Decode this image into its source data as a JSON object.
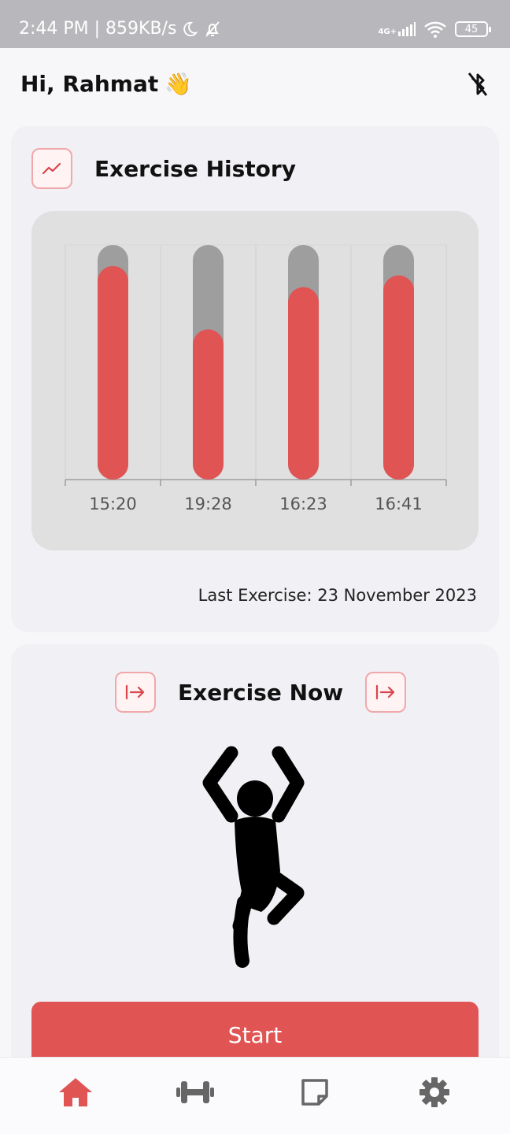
{
  "status_bar": {
    "time_speed": "2:44 PM | 859KB/s",
    "network": "4G+",
    "battery": "45"
  },
  "header": {
    "greeting": "Hi, Rahmat",
    "wave_emoji": "👋",
    "bluetooth_icon": "bluetooth-off-icon"
  },
  "history": {
    "title": "Exercise History",
    "icon": "trend-chart-icon",
    "last_exercise": "Last Exercise: 23 November 2023"
  },
  "chart_data": {
    "type": "bar",
    "categories": [
      "15:20",
      "19:28",
      "16:23",
      "16:41"
    ],
    "values": [
      0.91,
      0.64,
      0.82,
      0.87
    ],
    "ylim": [
      0,
      1
    ],
    "colors": {
      "bar": "#e05454",
      "track": "#9e9e9e",
      "panel": "#e0e0e0"
    },
    "grid": true
  },
  "exercise_now": {
    "title": "Exercise Now",
    "left_icon": "arrow-right-to-bar-icon",
    "right_icon": "arrow-right-to-bar-icon",
    "figure": "tree-pose-person-icon",
    "start_label": "Start"
  },
  "bottom_nav": {
    "items": [
      {
        "icon": "home-icon",
        "active": true
      },
      {
        "icon": "dumbbell-icon",
        "active": false
      },
      {
        "icon": "note-icon",
        "active": false
      },
      {
        "icon": "gear-icon",
        "active": false
      }
    ],
    "accent": "#e05454",
    "inactive": "#666666"
  }
}
